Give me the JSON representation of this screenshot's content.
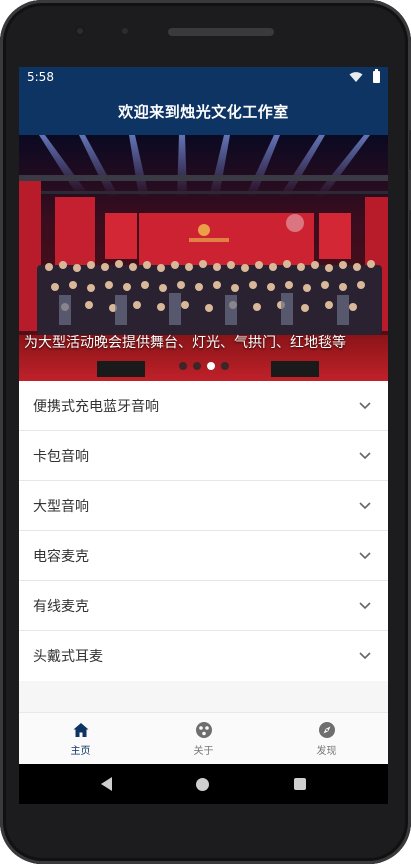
{
  "status_bar": {
    "time": "5:58",
    "icons": [
      "wifi-icon",
      "battery-icon"
    ]
  },
  "app_bar": {
    "title": "欢迎来到烛光文化工作室"
  },
  "banner": {
    "caption": "为大型活动晚会提供舞台、灯光、气拱门、红地毯等",
    "slide_count": 4,
    "active_slide_index": 2
  },
  "products": [
    {
      "label": "便携式充电蓝牙音响"
    },
    {
      "label": "卡包音响"
    },
    {
      "label": "大型音响"
    },
    {
      "label": "电容麦克"
    },
    {
      "label": "有线麦克"
    },
    {
      "label": "头戴式耳麦"
    }
  ],
  "tabs": [
    {
      "label": "主页",
      "icon": "home-icon",
      "active": true
    },
    {
      "label": "关于",
      "icon": "about-icon",
      "active": false
    },
    {
      "label": "发现",
      "icon": "compass-icon",
      "active": false
    }
  ],
  "colors": {
    "primary": "#0e3464",
    "tab_inactive": "#777777",
    "background": "#f6f6f6"
  }
}
